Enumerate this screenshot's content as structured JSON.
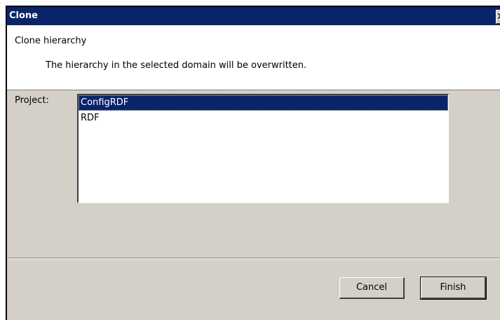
{
  "window": {
    "title": "Clone",
    "close_glyph": "✕"
  },
  "banner": {
    "title": "Clone hierarchy",
    "message": "The hierarchy in the selected domain will be overwritten."
  },
  "project": {
    "label": "Project:",
    "items": [
      "ConfigRDF",
      "RDF"
    ],
    "selected": "ConfigRDF"
  },
  "buttons": {
    "cancel": "Cancel",
    "finish": "Finish"
  },
  "colors": {
    "titlebar": "#0a246a",
    "selection": "#0a246a",
    "dialog_face": "#d4d0c8"
  }
}
